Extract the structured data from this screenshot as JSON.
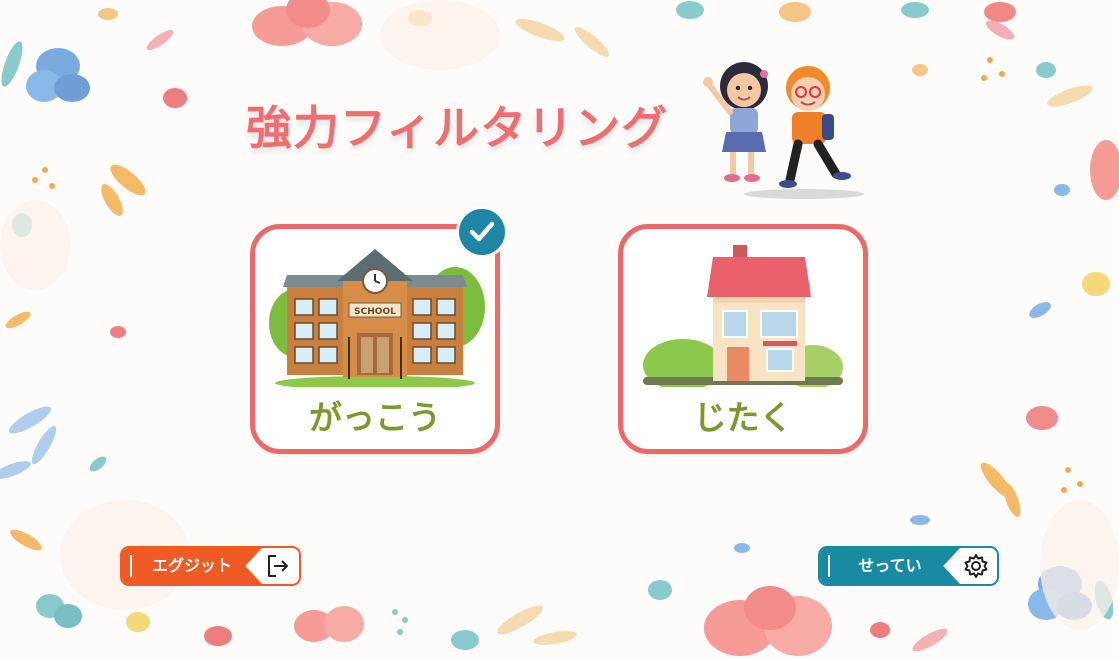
{
  "title": "強力フィルタリング",
  "modes": [
    {
      "label": "がっこう",
      "icon": "school-building",
      "selected": true
    },
    {
      "label": "じたく",
      "icon": "house",
      "selected": false
    }
  ],
  "buttons": {
    "exit_label": "エグジット",
    "exit_icon": "exit-icon",
    "settings_label": "せってい",
    "settings_icon": "gear-icon"
  },
  "school_sign": "SCHOOL",
  "colors": {
    "title": "#ef6f70",
    "card_border": "#ee6869",
    "label_text": "#7a9a2c",
    "check_badge": "#1f86a6",
    "exit_button": "#f05a24",
    "settings_button": "#1a8aa3"
  }
}
